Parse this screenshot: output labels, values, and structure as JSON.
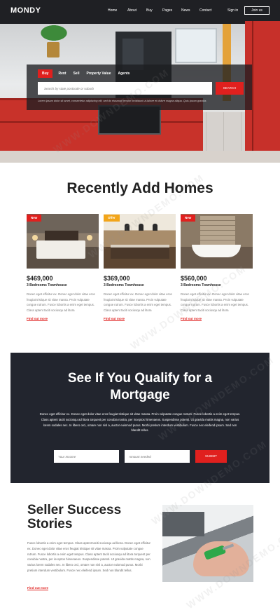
{
  "nav": {
    "logo": "MONDY",
    "menu": [
      "Home",
      "About",
      "Buy",
      "Pages",
      "News",
      "Contact"
    ],
    "signin": "Sign in",
    "join": "Join us"
  },
  "search": {
    "tabs": [
      "Buy",
      "Rent",
      "Sell",
      "Property Value",
      "Agents"
    ],
    "placeholder": "Search by state postcode or suburb",
    "button": "SEARCH",
    "note": "Lorem ipsum dolor sit amet, consectetur adipiscing elit, sed do eiusmod tempor incididunt ut labore et dolore magna aliqua. Quis ipsum gravida."
  },
  "recent": {
    "title": "Recently Add Homes",
    "cards": [
      {
        "badge": "New",
        "badge_color": "#e0201e",
        "price": "$469,000",
        "type": "3 Bedrooms Townhouse",
        "desc": "Donec eget efficitur ex. Donec eget dolor vitae eros feugiat tristique sit vitae massa. Proin vulputate congue rutrum. Fusce lobortis a enim eget tempus. Class aptent taciti sociosqu ad litora",
        "link": "Find out more"
      },
      {
        "badge": "Offer",
        "badge_color": "#f2a51a",
        "price": "$369,000",
        "type": "3 Bedrooms Townhouse",
        "desc": "Donec eget efficitur ex. Donec eget dolor vitae eros feugiat tristique sit vitae massa. Proin vulputate congue rutrum. Fusce lobortis a enim eget tempus. Class aptent taciti sociosqu ad litora",
        "link": "Find out more"
      },
      {
        "badge": "New",
        "badge_color": "#e0201e",
        "price": "$560,000",
        "type": "3 Bedrooms Townhouse",
        "desc": "Donec eget efficitur ex. Donec eget dolor vitae eros feugiat tristique sit vitae massa. Proin vulputate congue rutrum. Fusce lobortis a enim eget tempus. Class aptent taciti sociosqu ad litora",
        "link": "Find out more"
      }
    ]
  },
  "mortgage": {
    "title_line1": "See If You Qualify for a",
    "title_line2": "Mortgage",
    "text": "Donec eget efficitur ex. Donec eget dolor vitae eros feugiat tristique sit vitae massa. Proin vulputate congue rutrum. Fusce lobortis a enim eget tempus. Class aptent taciti sociosqu ad litora torquent per conubia nostra, per inceptos himenaeos. Suspendisse potenti. Ut gravida mattis magna, non varius lorem sodales nec. In libero orci, ornare non nisl a, auctor euismod purus. Morbi pretium interdum vestibulum. Fusce nec eleifend ipsum. Sed non blandit tellus.",
    "income_placeholder": "Your Income",
    "amount_placeholder": "Amount needed",
    "submit": "SUBMIT"
  },
  "seller": {
    "title_line1": "Seller Success",
    "title_line2": "Stories",
    "text": "Fusce lobortis a enim eget tempus. Class aptent taciti sociosqu ad litora. Donec eget efficitur ex. Donec eget dolor vitae eros feugiat tristique sit vitae massa. Proin vulputate congue rutrum. Fusce lobortis a enim eget tempus. Class aptent taciti sociosqu ad litora torquent per conubia nostra, per inceptos himenaeos. Suspendisse potenti. Ut gravida mattis magna, non varius lorem sodales nec. In libero orci, ornare non nisl a, auctor euismod purus. Morbi pretium interdum vestibulum. Fusce nec eleifend ipsum. Sed non blandit tellus.",
    "link": "Find out more"
  },
  "watermark": "WWW.DOWNDEMO.COM"
}
